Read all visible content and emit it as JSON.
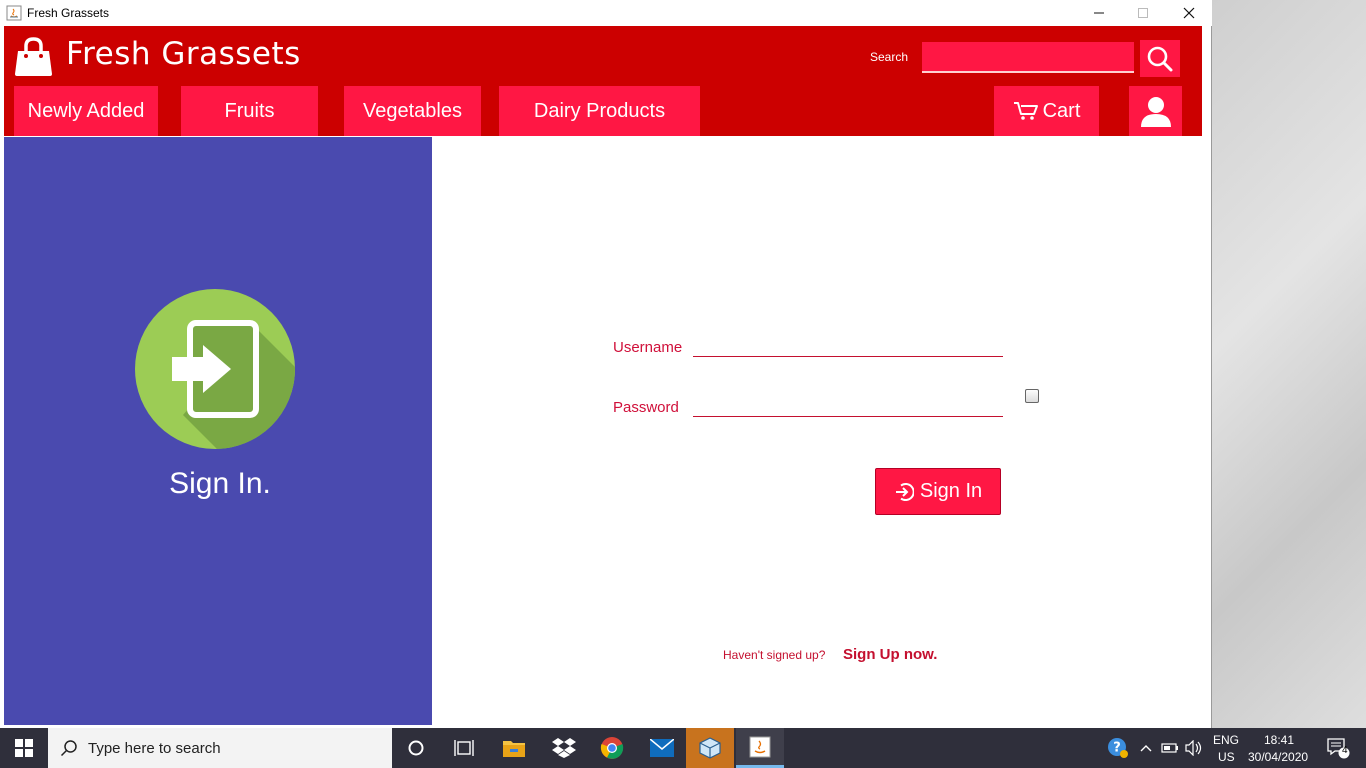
{
  "window": {
    "title": "Fresh Grassets"
  },
  "header": {
    "brand": "Fresh Grassets",
    "search_label": "Search",
    "search_value": "",
    "nav": {
      "newly_added": "Newly Added",
      "fruits": "Fruits",
      "vegetables": "Vegetables",
      "dairy": "Dairy Products",
      "cart": "Cart"
    }
  },
  "left_panel": {
    "heading": "Sign In."
  },
  "form": {
    "username_label": "Username",
    "password_label": "Password",
    "username_value": "",
    "password_value": "",
    "show_password_checked": false,
    "signin_label": "Sign In",
    "signup_prompt": "Haven't signed up?",
    "signup_link": "Sign Up now."
  },
  "taskbar": {
    "search_placeholder": "Type here to search",
    "lang_top": "ENG",
    "lang_bottom": "US",
    "time": "18:41",
    "date": "30/04/2020",
    "notification_count": "4"
  },
  "colors": {
    "header_red": "#cc0000",
    "accent_pink": "#ff1744",
    "panel_blue": "#4a4aaf",
    "icon_green": "#9ccc55"
  }
}
